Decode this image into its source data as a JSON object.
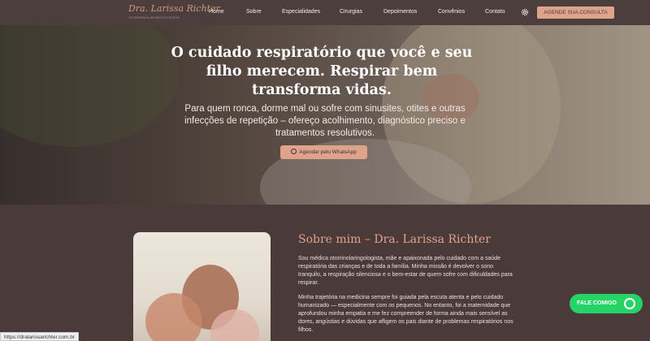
{
  "header": {
    "logo_name": "Dra. Larissa Richter",
    "logo_sub": "OTORRINOLARINGOLOGISTA",
    "nav": [
      "Home",
      "Sobre",
      "Especialidades",
      "Cirurgias",
      "Depoimentos",
      "Convênios",
      "Contato"
    ],
    "settings_icon": "gear-icon",
    "cta": "AGENDE SUA CONSULTA"
  },
  "hero": {
    "title": "O cuidado respiratório que você e seu filho merecem. Respirar bem transforma vidas.",
    "subtitle": "Para quem ronca, dorme mal ou sofre com sinusites, otites e outras infecções de repetição – ofereço acolhimento, diagnóstico preciso e tratamentos resolutivos.",
    "button": "Agendar pelo WhatsApp",
    "button_icon": "whatsapp-icon"
  },
  "about": {
    "title": "Sobre mim – Dra. Larissa Richter",
    "p1": "Sou médica otorrinolaringologista, mãe e apaixonada pelo cuidado com a saúde respiratória das crianças e de toda a família. Minha missão é devolver o sono tranquilo, a respiração silenciosa e o bem-estar de quem sofre com dificuldades para respirar.",
    "p2": "Minha trajetória na medicina sempre foi guiada pela escuta atenta e pelo cuidado humanizado — especialmente com os pequenos. No entanto, foi a maternidade que aprofundou minha empatia e me fez compreender de forma ainda mais sensível as dores, angústias e dúvidas que afligem os pais diante de problemas respiratórios nos filhos."
  },
  "floating": {
    "fale": "FALE COMIGO",
    "fale_icon": "whatsapp-icon"
  },
  "status_url": "https://dralarissarichter.com.br"
}
